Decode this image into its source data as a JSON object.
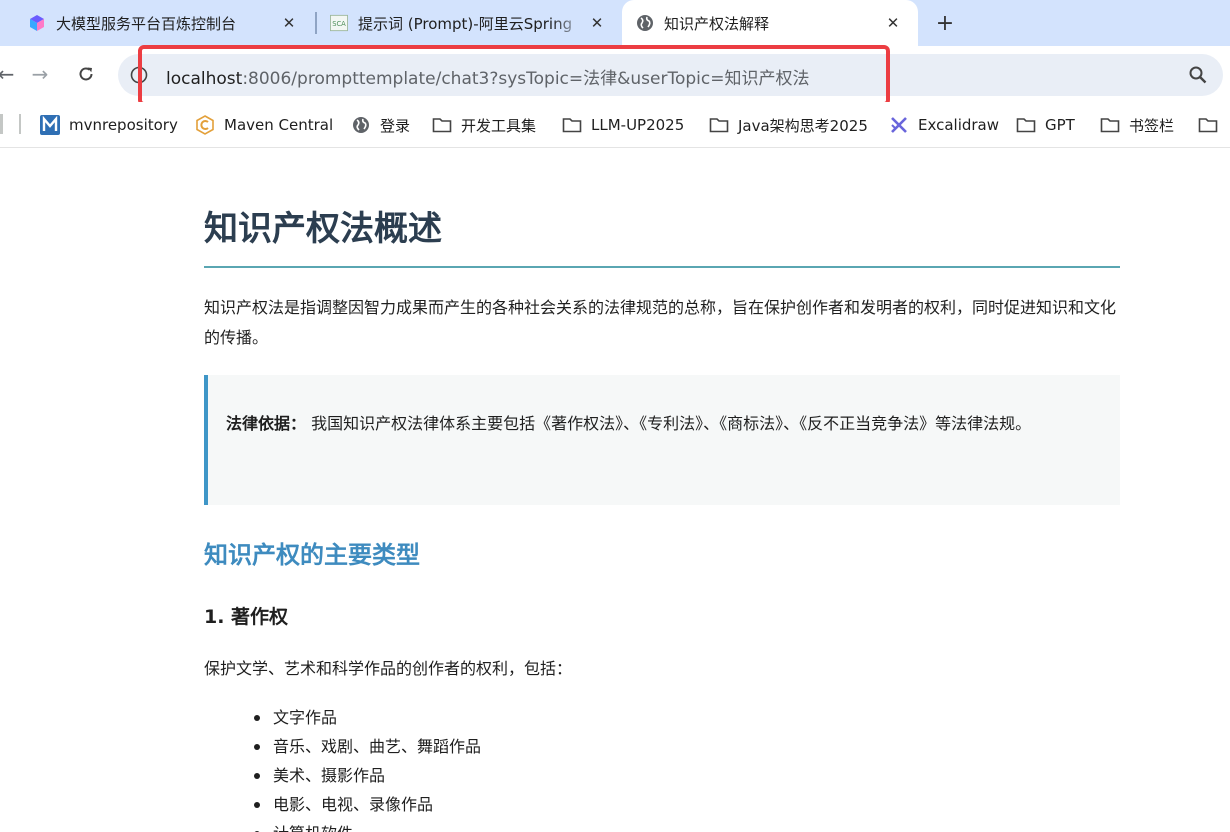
{
  "tabs": [
    {
      "title": "大模型服务平台百炼控制台",
      "icon": "bailian-logo-icon"
    },
    {
      "title": "提示词 (Prompt)-阿里云Spring",
      "icon": "sca-favicon",
      "favicon_text": "SCA"
    },
    {
      "title": "知识产权法解释",
      "icon": "globe-icon",
      "active": true
    }
  ],
  "toolbar": {
    "url_host": "localhost",
    "url_rest": ":8006/prompttemplate/chat3?sysTopic=法律&userTopic=知识产权法",
    "highlight_color": "#ec3d42"
  },
  "bookmarks": [
    {
      "label": "mvnrepository",
      "icon": "maven-m-icon"
    },
    {
      "label": "Maven Central",
      "icon": "maven-central-icon"
    },
    {
      "label": "登录",
      "icon": "globe-icon"
    },
    {
      "label": "开发工具集",
      "icon": "folder-icon"
    },
    {
      "label": "LLM-UP2025",
      "icon": "folder-icon"
    },
    {
      "label": "Java架构思考2025",
      "icon": "folder-icon"
    },
    {
      "label": "Excalidraw",
      "icon": "excalidraw-icon"
    },
    {
      "label": "GPT",
      "icon": "folder-icon"
    },
    {
      "label": "书签栏",
      "icon": "folder-icon"
    }
  ],
  "article": {
    "title": "知识产权法概述",
    "intro": "知识产权法是指调整因智力成果而产生的各种社会关系的法律规范的总称，旨在保护创作者和发明者的权利，同时促进知识和文化的传播。",
    "callout_label": "法律依据：",
    "callout_text": " 我国知识产权法律体系主要包括《著作权法》、《专利法》、《商标法》、《反不正当竞争法》等法律法规。",
    "section_title": "知识产权的主要类型",
    "subsection_title": "1. 著作权",
    "subsection_text": "保护文学、艺术和科学作品的创作者的权利，包括：",
    "list": [
      "文字作品",
      "音乐、戏剧、曲艺、舞蹈作品",
      "美术、摄影作品",
      "电影、电视、录像作品",
      "计算机软件"
    ]
  },
  "colors": {
    "title": "#2c3e50",
    "rule": "#5aa6b2",
    "section_title": "#3e8bbf",
    "callout_border": "#3f96c7",
    "tabstrip_bg": "#d3e3fd"
  }
}
